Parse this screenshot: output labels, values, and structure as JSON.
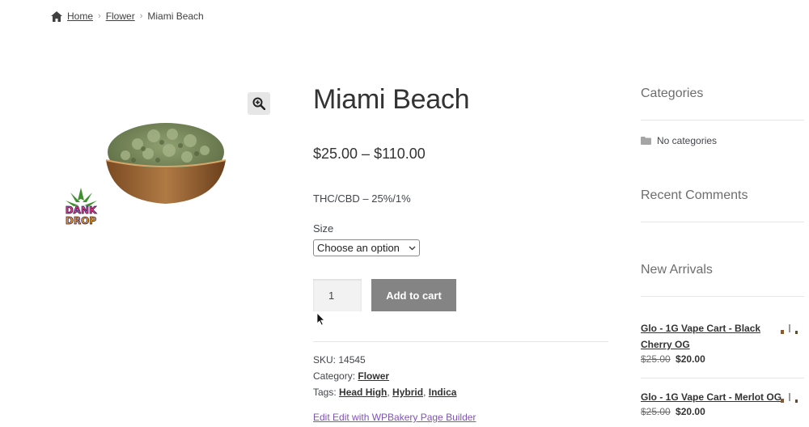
{
  "breadcrumb": {
    "home": "Home",
    "category": "Flower",
    "current": "Miami Beach",
    "separator": "›"
  },
  "product": {
    "title": "Miami Beach",
    "price": "$25.00 – $110.00",
    "description": "THC/CBD – 25%/1%",
    "size_label": "Size",
    "size_select_value": "Choose an option",
    "quantity": "1",
    "add_to_cart": "Add to cart",
    "logo_text": "DANK DROP",
    "meta": {
      "sku_label": "SKU:",
      "sku": "14545",
      "category_label": "Category:",
      "category": "Flower",
      "tags_label": "Tags:",
      "tags": [
        "Head High",
        "Hybrid",
        "Indica"
      ]
    },
    "edit_link": "Edit Edit with WPBakery Page Builder"
  },
  "sidebar": {
    "categories_title": "Categories",
    "no_categories": "No categories",
    "recent_comments_title": "Recent Comments",
    "new_arrivals_title": "New Arrivals",
    "new_arrivals": [
      {
        "name": "Glo - 1G Vape Cart - Black Cherry OG",
        "old_price": "$25.00",
        "new_price": "$20.00"
      },
      {
        "name": "Glo - 1G Vape Cart - Merlot OG",
        "old_price": "$25.00",
        "new_price": "$20.00"
      }
    ]
  },
  "colors": {
    "button": "#848484",
    "link_purple": "#7f54b3",
    "text": "#43454b"
  }
}
